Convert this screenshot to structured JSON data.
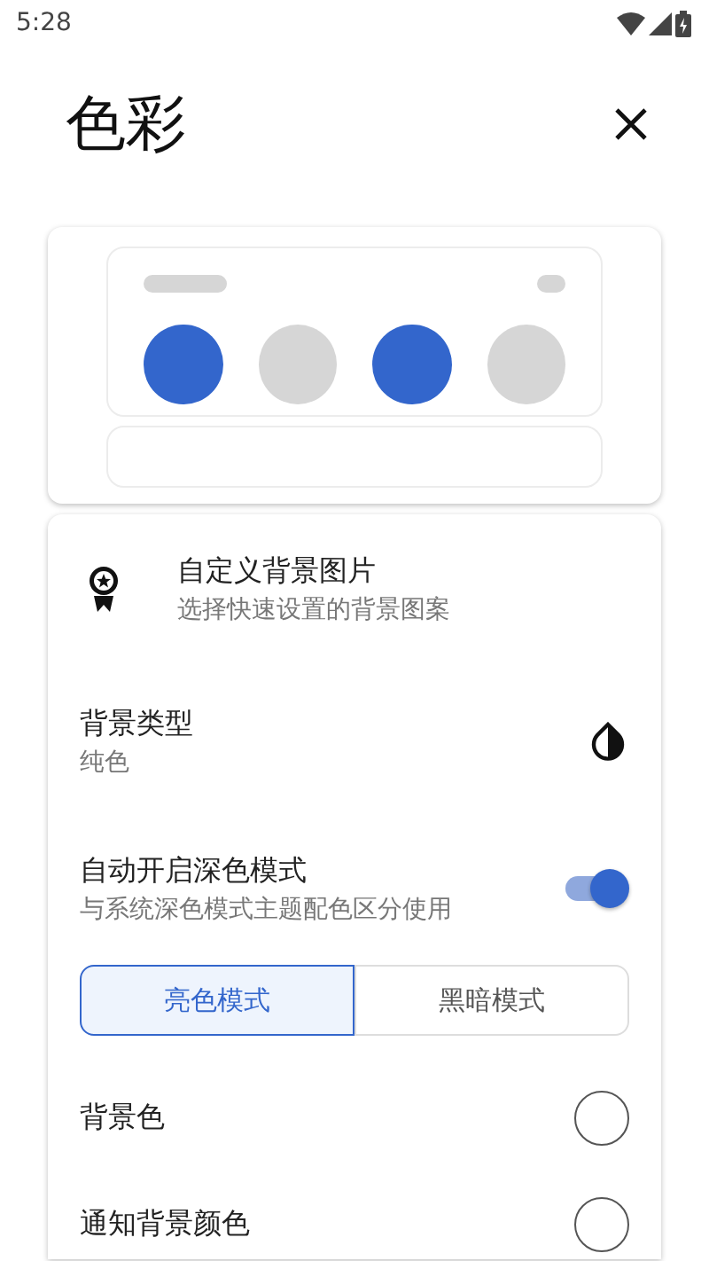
{
  "status_bar": {
    "time": "5:28"
  },
  "header": {
    "title": "色彩"
  },
  "preview": {
    "dots": [
      {
        "color": "#3366cc"
      },
      {
        "color": "#d6d6d6"
      },
      {
        "color": "#3366cc"
      },
      {
        "color": "#d6d6d6"
      }
    ]
  },
  "settings": [
    {
      "kind": "image",
      "title": "自定义背景图片",
      "subtitle": "选择快速设置的背景图案"
    },
    {
      "kind": "type",
      "title": "背景类型",
      "subtitle": "纯色"
    },
    {
      "kind": "toggle",
      "title": "自动开启深色模式",
      "subtitle": "与系统深色模式主题配色区分使用",
      "on": true
    },
    {
      "kind": "segmented",
      "options": [
        {
          "label": "亮色模式",
          "selected": true
        },
        {
          "label": "黑暗模式",
          "selected": false
        }
      ]
    },
    {
      "kind": "color",
      "title": "背景色",
      "color": "#ffffff"
    },
    {
      "kind": "color",
      "title": "通知背景颜色",
      "color": "#ffffff"
    }
  ]
}
